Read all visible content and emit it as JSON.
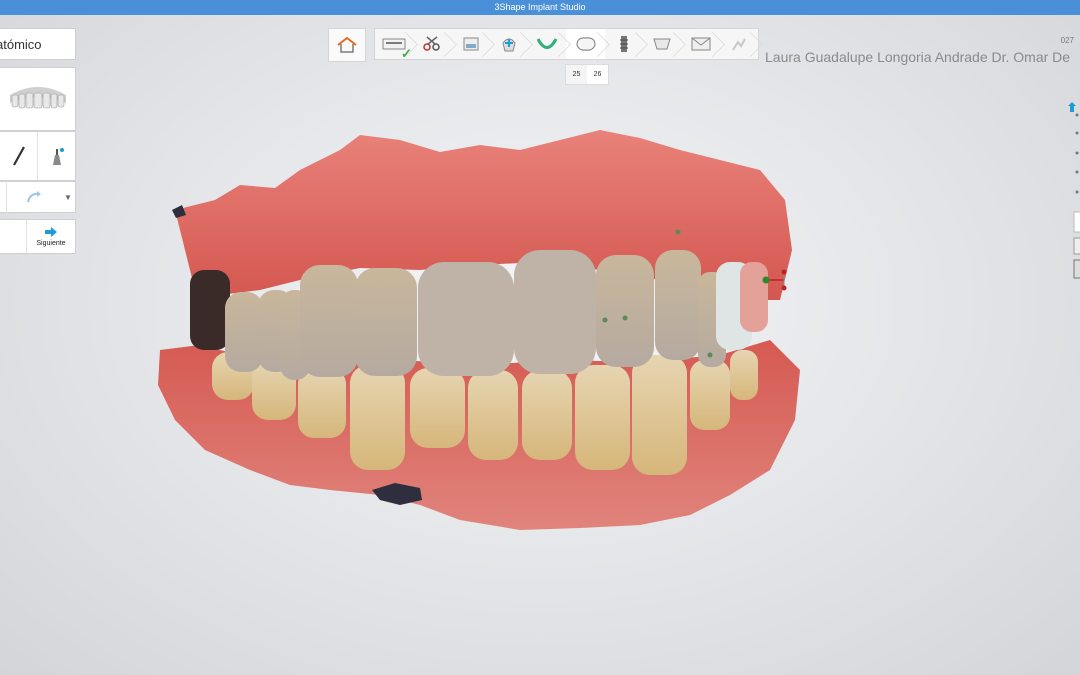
{
  "app": {
    "title": "3Shape Implant Studio"
  },
  "left_panel": {
    "title": "atómico",
    "next_label": "Siguiente"
  },
  "workflow": {
    "steps": [
      "home",
      "order-form",
      "scan-trim",
      "scan-view",
      "implant-plan",
      "arch",
      "crown-design",
      "implant",
      "abutment",
      "export",
      "finish"
    ],
    "active_step": "crown-design",
    "subtabs": [
      "25",
      "26"
    ],
    "active_subtab": "26"
  },
  "header": {
    "case_id": "027",
    "patient_name": "Laura Guadalupe Longoria Andrade Dr. Omar De"
  },
  "colors": {
    "titlebar": "#4a90d9",
    "accent": "#1e9ad6",
    "check": "#3cb043",
    "gum": "#d9645e",
    "tooth": "#d8c5a6"
  }
}
